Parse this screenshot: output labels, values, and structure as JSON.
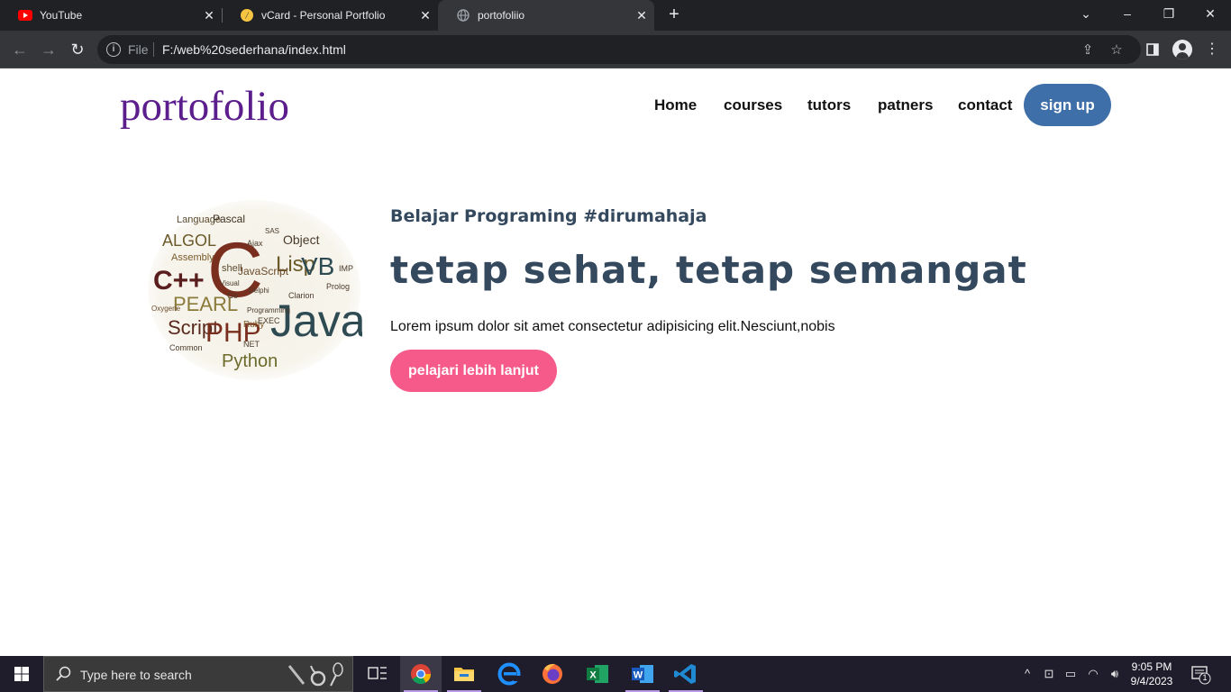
{
  "browser": {
    "tabs": [
      {
        "title": "YouTube",
        "icon": "youtube-icon"
      },
      {
        "title": "vCard - Personal Portfolio",
        "icon": "vcard-icon"
      },
      {
        "title": "portofoliio",
        "icon": "globe-icon",
        "active": true
      }
    ],
    "address": {
      "scheme_label": "File",
      "url": "F:/web%20sederhana/index.html"
    }
  },
  "site": {
    "logo": "portofolio",
    "nav": [
      "Home",
      "courses",
      "tutors",
      "patners",
      "contact"
    ],
    "signup_label": "sign up",
    "hero": {
      "tagline": "Belajar Programing #dirumahaja",
      "headline": "tetap sehat, tetap semangat",
      "body": "Lorem ipsum dolor sit amet consectetur adipisicing elit.Nesciunt,nobis",
      "cta_label": "pelajari lebih lanjut"
    },
    "word_cloud": {
      "words": [
        "Language",
        "Pascal",
        "ALGOL",
        "C",
        "Object",
        "Lisp",
        "VB",
        "C++",
        "Assembly",
        "shell",
        "JavaScript",
        "PEARL",
        "Java",
        "Script",
        "PHP",
        "Ruby",
        "Python",
        "Common",
        "Prolog",
        "Visual",
        "Programming",
        "Delphi",
        "NET",
        "EXEC",
        "IMP",
        "Oxygene",
        "Ajax",
        "SAS",
        "Clarion",
        "Go"
      ]
    },
    "colors": {
      "logo": "#5b1e8c",
      "signup": "#3f6fa8",
      "heading": "#34495e",
      "cta": "#f55a8a"
    }
  },
  "taskbar": {
    "search_placeholder": "Type here to search",
    "apps": [
      "chrome-icon",
      "file-explorer-icon",
      "edge-icon",
      "firefox-icon",
      "excel-icon",
      "word-icon",
      "vscode-icon"
    ],
    "time": "9:05 PM",
    "date": "9/4/2023",
    "notification_count": "1"
  }
}
